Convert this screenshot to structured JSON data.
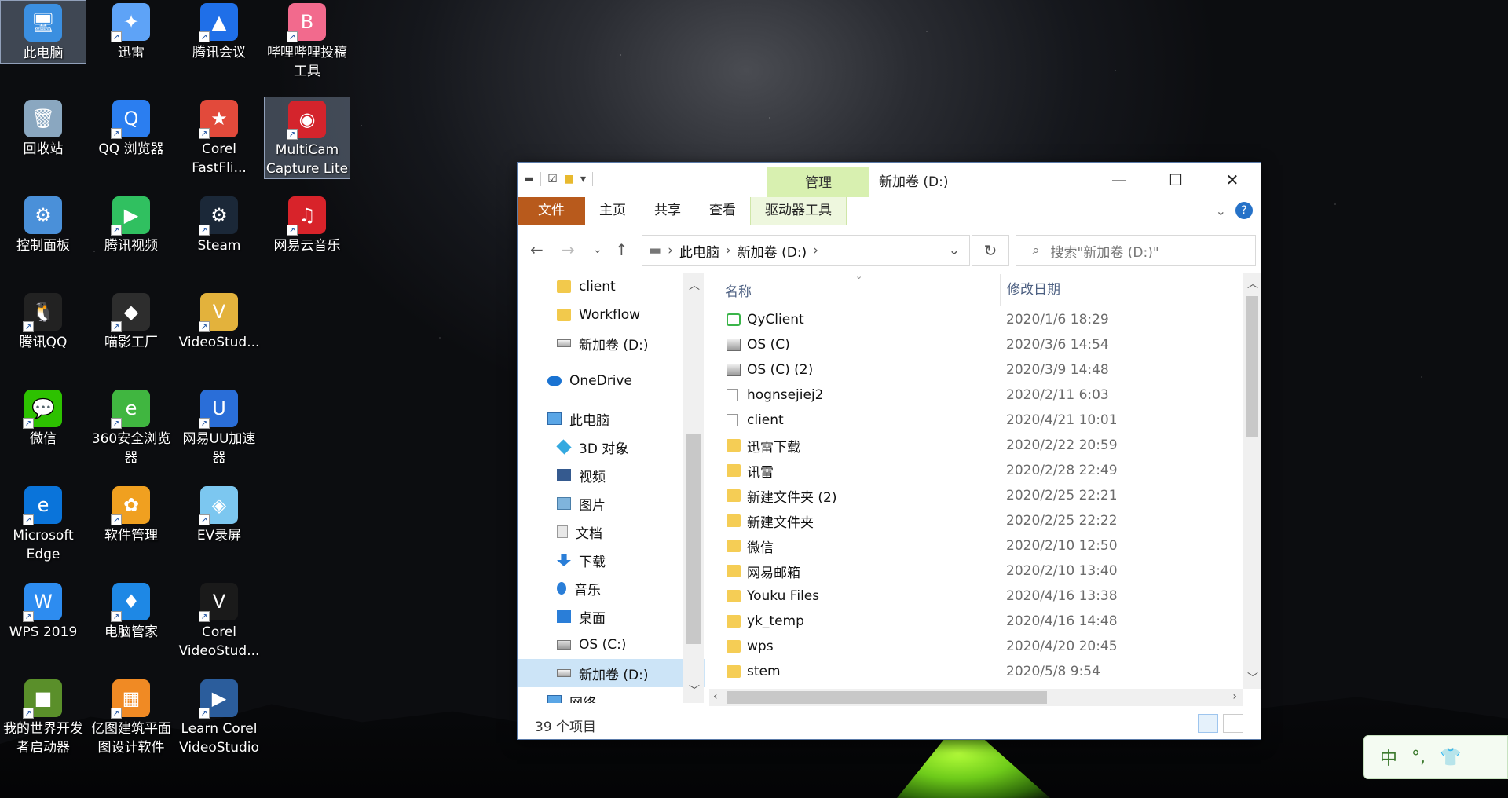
{
  "desktop": {
    "icons": [
      {
        "label": "此电脑",
        "icon": "computer-icon",
        "color": "#3b8fe0",
        "glyph": "🖥"
      },
      {
        "label": "迅雷",
        "icon": "xunlei-icon",
        "color": "#5ea3f7",
        "glyph": "✦"
      },
      {
        "label": "腾讯会议",
        "icon": "tencent-meeting-icon",
        "color": "#1f6fe8",
        "glyph": "▲"
      },
      {
        "label": "哔哩哔哩投稿\n工具",
        "icon": "bilibili-icon",
        "color": "#f26a8d",
        "glyph": "B"
      },
      {
        "label": "回收站",
        "icon": "recycle-bin-icon",
        "color": "#8aa7c0",
        "glyph": "🗑"
      },
      {
        "label": "QQ 浏览器",
        "icon": "qq-browser-icon",
        "color": "#2b7ef0",
        "glyph": "Q"
      },
      {
        "label": "Corel\nFastFli...",
        "icon": "corel-fastflick-icon",
        "color": "#e24a3b",
        "glyph": "★"
      },
      {
        "label": "MultiCam\nCapture Lite",
        "icon": "multicam-icon",
        "color": "#d4242c",
        "glyph": "◉"
      },
      {
        "label": "控制面板",
        "icon": "control-panel-icon",
        "color": "#4a90d9",
        "glyph": "⚙"
      },
      {
        "label": "腾讯视频",
        "icon": "tencent-video-icon",
        "color": "#30c060",
        "glyph": "▶"
      },
      {
        "label": "Steam",
        "icon": "steam-icon",
        "color": "#1b2838",
        "glyph": "⚙"
      },
      {
        "label": "网易云音乐",
        "icon": "netease-music-icon",
        "color": "#d8232a",
        "glyph": "♫"
      },
      {
        "label": "腾讯QQ",
        "icon": "qq-icon",
        "color": "#222",
        "glyph": "🐧"
      },
      {
        "label": "喵影工厂",
        "icon": "filmora-icon",
        "color": "#2d2d2d",
        "glyph": "◆"
      },
      {
        "label": "VideoStud...",
        "icon": "videostudio-icon",
        "color": "#e3b23c",
        "glyph": "V"
      },
      {
        "label": "微信",
        "icon": "wechat-icon",
        "color": "#2dc100",
        "glyph": "💬"
      },
      {
        "label": "360安全浏览\n器",
        "icon": "360-browser-icon",
        "color": "#40b640",
        "glyph": "e"
      },
      {
        "label": "网易UU加速\n器",
        "icon": "uu-booster-icon",
        "color": "#2a6ed8",
        "glyph": "U"
      },
      {
        "label": "Microsoft\nEdge",
        "icon": "edge-icon",
        "color": "#0a74da",
        "glyph": "e"
      },
      {
        "label": "软件管理",
        "icon": "software-manager-icon",
        "color": "#f0a020",
        "glyph": "✿"
      },
      {
        "label": "EV录屏",
        "icon": "ev-recorder-icon",
        "color": "#7cc7f0",
        "glyph": "◈"
      },
      {
        "label": "WPS 2019",
        "icon": "wps-icon",
        "color": "#2d8cf0",
        "glyph": "W"
      },
      {
        "label": "电脑管家",
        "icon": "pc-manager-icon",
        "color": "#1e88e5",
        "glyph": "♦"
      },
      {
        "label": "Corel\nVideoStud...",
        "icon": "corel-videostudio-icon",
        "color": "#1a1a1a",
        "glyph": "V"
      },
      {
        "label": "我的世界开发\n者启动器",
        "icon": "minecraft-icon",
        "color": "#5a8f2a",
        "glyph": "■"
      },
      {
        "label": "亿图建筑平面\n图设计软件",
        "icon": "edraw-icon",
        "color": "#f08a24",
        "glyph": "▦"
      },
      {
        "label": "Learn Corel\nVideoStudio",
        "icon": "learn-videostudio-icon",
        "color": "#2b5d9c",
        "glyph": "▶"
      }
    ]
  },
  "explorer": {
    "title": "新加卷 (D:)",
    "context_tab": "管理",
    "ribbon_tabs": [
      "文件",
      "主页",
      "共享",
      "查看",
      "驱动器工具"
    ],
    "address": {
      "crumbs": [
        "此电脑",
        "新加卷 (D:)"
      ]
    },
    "search_placeholder": "搜索\"新加卷 (D:)\"",
    "nav_items": [
      {
        "label": "client",
        "icon": "folder-icon",
        "cls": "folder",
        "indent": 1
      },
      {
        "label": "Workflow",
        "icon": "folder-icon",
        "cls": "folder",
        "indent": 1
      },
      {
        "label": "新加卷 (D:)",
        "icon": "drive-icon",
        "cls": "drive",
        "indent": 1
      },
      {
        "label": "",
        "icon": "",
        "cls": "",
        "indent": 0
      },
      {
        "label": "OneDrive",
        "icon": "onedrive-icon",
        "cls": "cloud",
        "indent": 0
      },
      {
        "label": "",
        "icon": "",
        "cls": "",
        "indent": 0
      },
      {
        "label": "此电脑",
        "icon": "computer-icon",
        "cls": "pc",
        "indent": 0
      },
      {
        "label": "3D 对象",
        "icon": "3d-objects-icon",
        "cls": "cube",
        "indent": 1
      },
      {
        "label": "视频",
        "icon": "videos-icon",
        "cls": "film",
        "indent": 1
      },
      {
        "label": "图片",
        "icon": "pictures-icon",
        "cls": "pic",
        "indent": 1
      },
      {
        "label": "文档",
        "icon": "documents-icon",
        "cls": "doc",
        "indent": 1
      },
      {
        "label": "下载",
        "icon": "downloads-icon",
        "cls": "dl",
        "indent": 1
      },
      {
        "label": "音乐",
        "icon": "music-icon",
        "cls": "note",
        "indent": 1
      },
      {
        "label": "桌面",
        "icon": "desktop-icon",
        "cls": "desk",
        "indent": 1
      },
      {
        "label": "OS (C:)",
        "icon": "os-drive-icon",
        "cls": "osdrive",
        "indent": 1
      },
      {
        "label": "新加卷 (D:)",
        "icon": "drive-icon",
        "cls": "drive",
        "indent": 1,
        "selected": true
      },
      {
        "label": "网络",
        "icon": "network-icon",
        "cls": "pc",
        "indent": 0
      }
    ],
    "columns": {
      "name": "名称",
      "date": "修改日期"
    },
    "files": [
      {
        "name": "QyClient",
        "date": "2020/1/6 18:29",
        "cls": "ficon-app",
        "icon": "app-icon"
      },
      {
        "name": "OS (C)",
        "date": "2020/3/6 14:54",
        "cls": "ficon-link",
        "icon": "shortcut-icon"
      },
      {
        "name": "OS (C) (2)",
        "date": "2020/3/9 14:48",
        "cls": "ficon-link",
        "icon": "shortcut-icon"
      },
      {
        "name": "hognsejiej2",
        "date": "2020/2/11 6:03",
        "cls": "ficon-file",
        "icon": "file-icon"
      },
      {
        "name": "client",
        "date": "2020/4/21 10:01",
        "cls": "ficon-file",
        "icon": "file-icon"
      },
      {
        "name": "迅雷下载",
        "date": "2020/2/22 20:59",
        "cls": "ficon-folder",
        "icon": "folder-icon"
      },
      {
        "name": "讯雷",
        "date": "2020/2/28 22:49",
        "cls": "ficon-folder",
        "icon": "folder-icon"
      },
      {
        "name": "新建文件夹 (2)",
        "date": "2020/2/25 22:21",
        "cls": "ficon-folder",
        "icon": "folder-icon"
      },
      {
        "name": "新建文件夹",
        "date": "2020/2/25 22:22",
        "cls": "ficon-folder",
        "icon": "folder-icon"
      },
      {
        "name": "微信",
        "date": "2020/2/10 12:50",
        "cls": "ficon-folder",
        "icon": "folder-icon"
      },
      {
        "name": "网易邮箱",
        "date": "2020/2/10 13:40",
        "cls": "ficon-folder",
        "icon": "folder-icon"
      },
      {
        "name": "Youku Files",
        "date": "2020/4/16 13:38",
        "cls": "ficon-folder",
        "icon": "folder-icon"
      },
      {
        "name": "yk_temp",
        "date": "2020/4/16 14:48",
        "cls": "ficon-folder",
        "icon": "folder-icon"
      },
      {
        "name": "wps",
        "date": "2020/4/20 20:45",
        "cls": "ficon-folder",
        "icon": "folder-icon"
      },
      {
        "name": "stem",
        "date": "2020/5/8 9:54",
        "cls": "ficon-folder",
        "icon": "folder-icon"
      }
    ],
    "status": {
      "count": "39 个项目"
    }
  },
  "ime": {
    "lang": "中",
    "punct": "°,",
    "skin": "👕"
  }
}
